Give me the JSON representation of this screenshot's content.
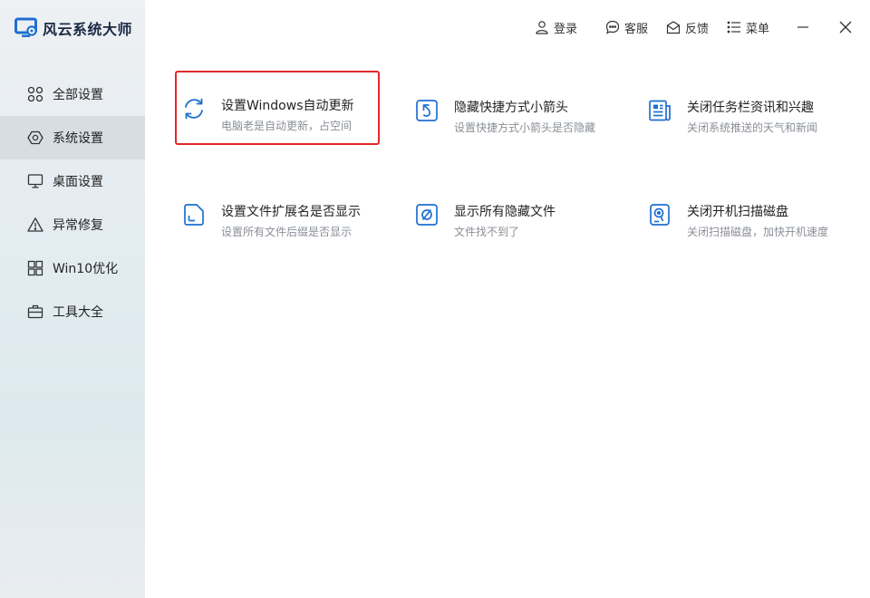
{
  "app": {
    "name": "风云系统大师",
    "logo_icon": "monitor-gear-icon",
    "accent_color": "#1f6fd1"
  },
  "topbar": {
    "login_label": "登录",
    "service_label": "客服",
    "feedback_label": "反馈",
    "menu_label": "菜单"
  },
  "sidebar": {
    "items": [
      {
        "label": "全部设置",
        "icon": "grid-icon"
      },
      {
        "label": "系统设置",
        "icon": "settings-icon"
      },
      {
        "label": "桌面设置",
        "icon": "monitor-icon"
      },
      {
        "label": "异常修复",
        "icon": "warning-icon"
      },
      {
        "label": "Win10优化",
        "icon": "windows-icon"
      },
      {
        "label": "工具大全",
        "icon": "toolbox-icon"
      }
    ],
    "active_index": 1
  },
  "cards": [
    {
      "title": "设置Windows自动更新",
      "desc": "电脑老是自动更新，占空间",
      "icon": "refresh-icon",
      "highlighted": true
    },
    {
      "title": "隐藏快捷方式小箭头",
      "desc": "设置快捷方式小箭头是否隐藏",
      "icon": "shortcut-arrow-icon"
    },
    {
      "title": "关闭任务栏资讯和兴趣",
      "desc": "关闭系统推送的天气和新闻",
      "icon": "news-icon"
    },
    {
      "title": "设置文件扩展名是否显示",
      "desc": "设置所有文件后缀是否显示",
      "icon": "file-icon"
    },
    {
      "title": "显示所有隐藏文件",
      "desc": "文件找不到了",
      "icon": "hidden-file-icon"
    },
    {
      "title": "关闭开机扫描磁盘",
      "desc": "关闭扫描磁盘，加快开机速度",
      "icon": "disk-scan-icon"
    }
  ]
}
